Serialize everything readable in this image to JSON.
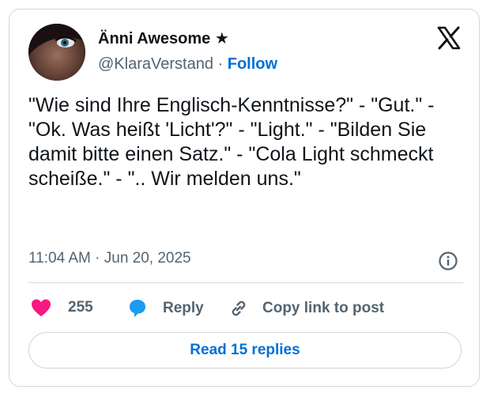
{
  "author": {
    "display_name": "Änni Awesome",
    "badge": "★",
    "handle": "@KlaraVerstand",
    "separator": "·",
    "follow_label": "Follow"
  },
  "tweet": {
    "text": "\"Wie sind Ihre Englisch-Kenntnisse?\" - \"Gut.\" - \"Ok. Was heißt 'Licht'?\" - \"Light.\" - \"Bilden Sie damit bitte einen Satz.\" - \"Cola Light schmeckt scheiße.\" - \".. Wir melden uns.\"",
    "timestamp": "11:04 AM · Jun 20, 2025"
  },
  "actions": {
    "like_count": "255",
    "reply_label": "Reply",
    "copy_label": "Copy link to post"
  },
  "footer": {
    "read_replies_label": "Read 15 replies"
  },
  "colors": {
    "accent": "#006fd6",
    "like": "#f91880",
    "reply": "#1d9bf0",
    "muted": "#536471",
    "border": "#cfd9de"
  },
  "icons": [
    "x-logo-icon",
    "info-icon",
    "heart-icon",
    "reply-bubble-icon",
    "link-icon"
  ]
}
